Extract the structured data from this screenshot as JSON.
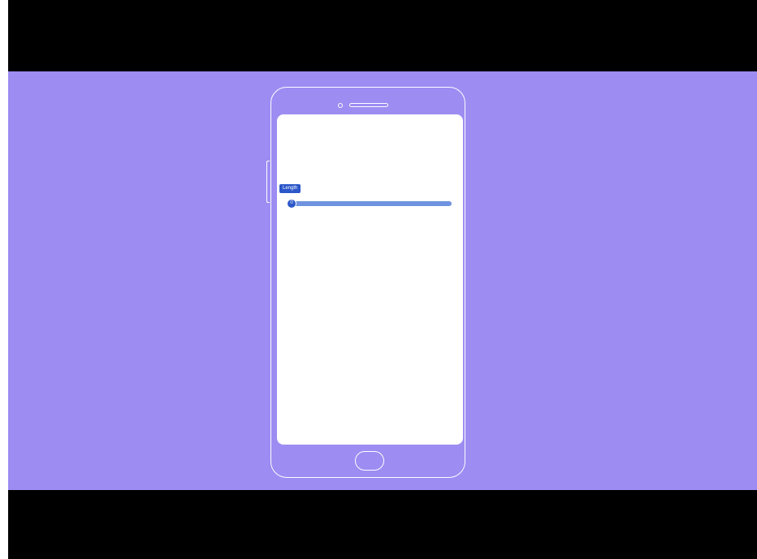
{
  "slider": {
    "label": "Length",
    "thumb_value": "0",
    "value_fraction": 0.0
  },
  "colors": {
    "stage_background": "#9d8cf2",
    "letterbox": "#000000",
    "slider_accent": "#2b57c9",
    "slider_track": "#6f93e0",
    "screen": "#ffffff"
  },
  "icons": [
    "front-camera-icon",
    "speaker-icon",
    "home-button-icon",
    "side-button-icon"
  ]
}
